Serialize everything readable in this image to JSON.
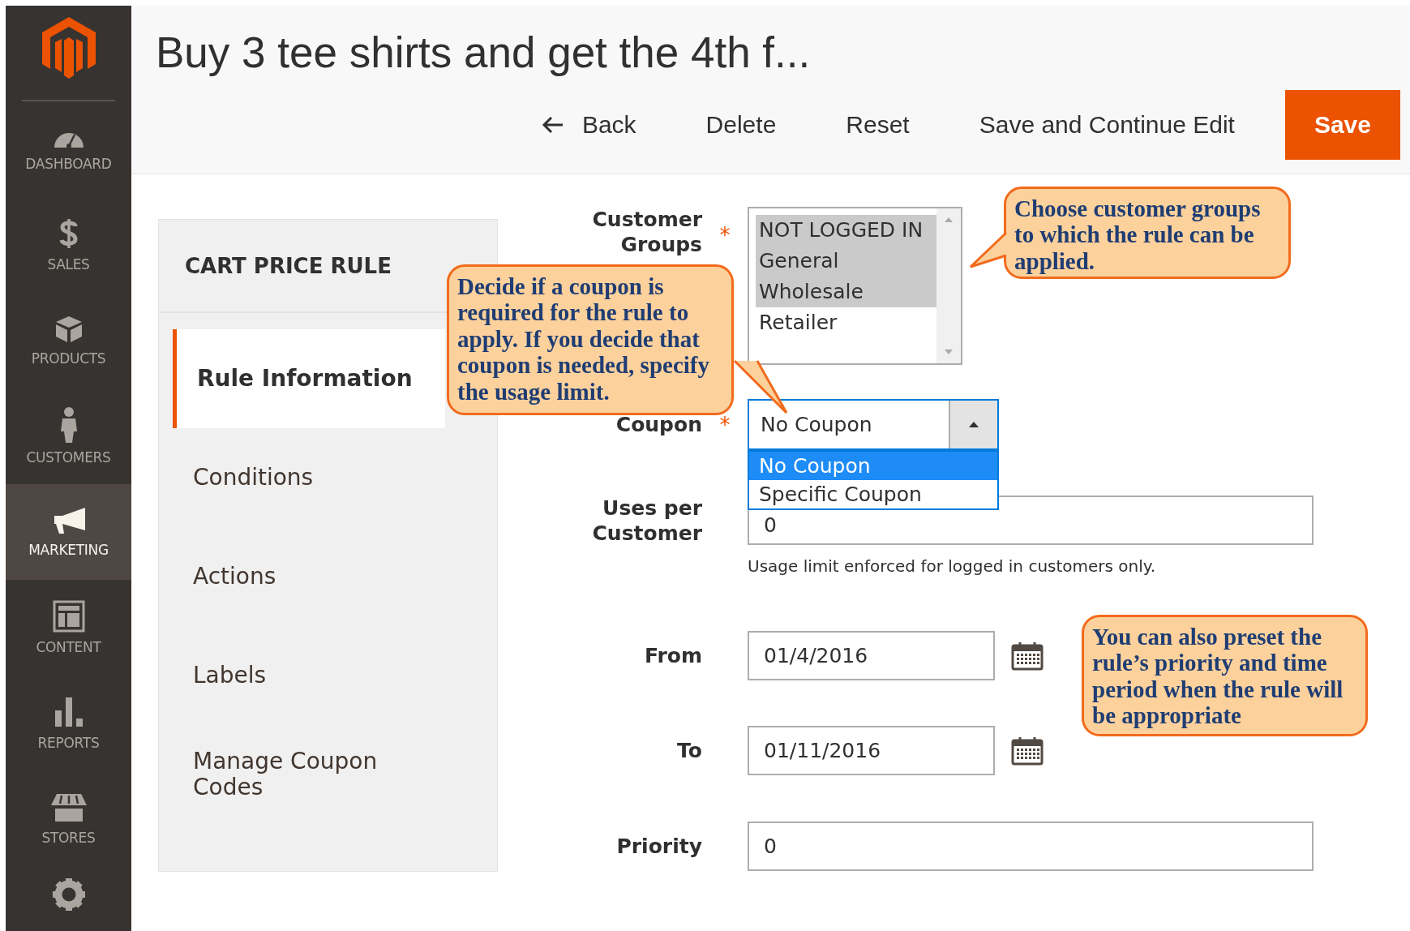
{
  "sidebar": {
    "items": [
      {
        "label": "DASHBOARD",
        "selected": false
      },
      {
        "label": "SALES",
        "selected": false
      },
      {
        "label": "PRODUCTS",
        "selected": false
      },
      {
        "label": "CUSTOMERS",
        "selected": false
      },
      {
        "label": "MARKETING",
        "selected": true
      },
      {
        "label": "CONTENT",
        "selected": false
      },
      {
        "label": "REPORTS",
        "selected": false
      },
      {
        "label": "STORES",
        "selected": false
      }
    ]
  },
  "page_title": "Buy 3 tee shirts and get the 4th f...",
  "actions": [
    {
      "label": "Back",
      "kind": "back"
    },
    {
      "label": "Delete",
      "kind": "plain"
    },
    {
      "label": "Reset",
      "kind": "plain"
    },
    {
      "label": "Save and Continue Edit",
      "kind": "plain"
    },
    {
      "label": "Save",
      "kind": "primary"
    }
  ],
  "panel": {
    "title": "CART PRICE RULE",
    "tabs": [
      {
        "label": "Rule Information",
        "selected": true
      },
      {
        "label": "Conditions",
        "selected": false
      },
      {
        "label": "Actions",
        "selected": false
      },
      {
        "label": "Labels",
        "selected": false
      },
      {
        "label": "Manage Coupon Codes",
        "selected": false
      }
    ]
  },
  "form": {
    "customer_groups": {
      "label": "Customer Groups",
      "required_mark": "*",
      "options": [
        {
          "label": "NOT LOGGED IN",
          "selected": true
        },
        {
          "label": "General",
          "selected": true
        },
        {
          "label": "Wholesale",
          "selected": true
        },
        {
          "label": "Retailer",
          "selected": false
        }
      ]
    },
    "coupon": {
      "label": "Coupon",
      "required_mark": "*",
      "value": "No Coupon",
      "expanded": true,
      "options": [
        {
          "label": "No Coupon",
          "selected": true
        },
        {
          "label": "Specific Coupon",
          "selected": false
        }
      ]
    },
    "uses_per_customer": {
      "label": "Uses per Customer",
      "value": "0",
      "note": "Usage limit enforced for logged in customers only."
    },
    "from": {
      "label": "From",
      "value": "01/4/2016"
    },
    "to": {
      "label": "To",
      "value": "01/11/2016"
    },
    "priority": {
      "label": "Priority",
      "value": "0"
    }
  },
  "callouts": [
    "Choose customer groups to which the rule can be applied.",
    "Decide if a coupon is required for the rule to apply. If you decide that coupon is needed, specify the usage limit.",
    "You can also preset the rule’s priority and time period when the rule will be appropriate"
  ]
}
